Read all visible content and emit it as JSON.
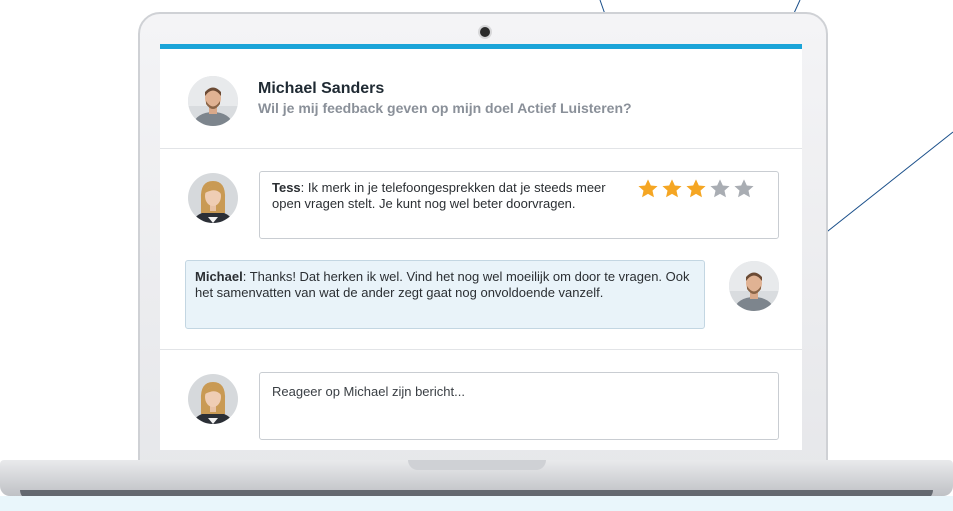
{
  "header": {
    "author_name": "Michael Sanders",
    "question": "Wil je mij feedback geven op mijn doel Actief Luisteren?"
  },
  "comments": [
    {
      "author": "Tess",
      "separator": ": ",
      "text": "Ik merk in je telefoongesprekken dat je steeds meer open vragen stelt. Je kunt nog wel beter doorvragen.",
      "rating": 3,
      "rating_max": 5
    },
    {
      "author": "Michael",
      "separator": ": ",
      "text": "Thanks! Dat herken ik wel. Vind het nog wel moeilijk om door te vragen. Ook het samenvatten van wat de ander zegt gaat nog onvoldoende vanzelf."
    }
  ],
  "reply": {
    "placeholder": "Reageer op Michael zijn bericht...",
    "value": ""
  },
  "colors": {
    "accent": "#1ba4d8",
    "star_filled": "#f5a623",
    "star_empty": "#a9adb3",
    "reply_bubble": "#e9f3f9"
  },
  "icons": {
    "rating": "star-icon",
    "camera": "webcam-icon"
  }
}
